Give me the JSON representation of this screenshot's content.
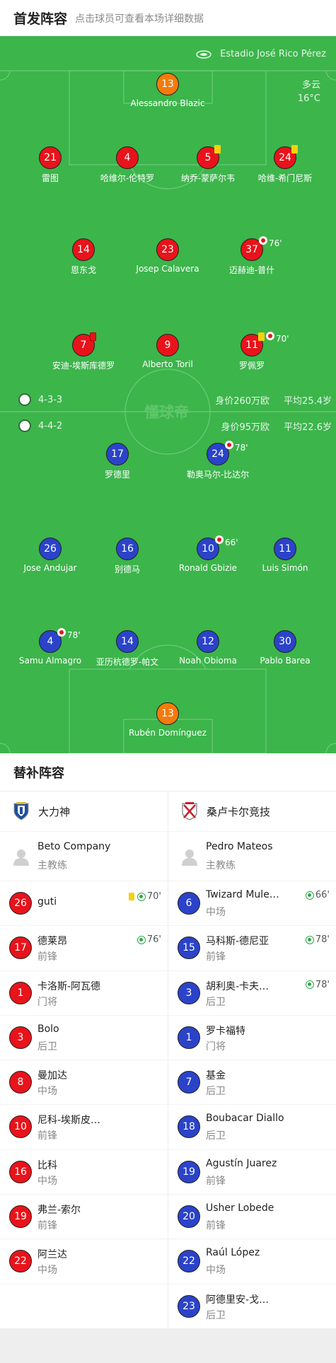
{
  "header": {
    "title": "首发阵容",
    "subtitle": "点击球员可查看本场详细数据"
  },
  "pitch": {
    "venue": "Estadio José Rico Pérez",
    "weather": "多云",
    "temperature": "16°C",
    "watermark": "懂球帝",
    "colors": {
      "grass": "#3cb54b",
      "home": "#e8131b",
      "away": "#2b43c9",
      "goalkeeper": "#f47a0b"
    }
  },
  "home": {
    "formation": "4-3-3",
    "value": "身价260万欧",
    "avg_age": "平均25.4岁",
    "players": [
      {
        "num": "13",
        "name": "Alessandro Blazic",
        "gk": true
      },
      {
        "num": "21",
        "name": "雷图"
      },
      {
        "num": "4",
        "name": "哈维尔-伦特罗"
      },
      {
        "num": "5",
        "name": "纳乔-蒙萨尔韦",
        "yellow": true
      },
      {
        "num": "24",
        "name": "哈维-希门尼斯",
        "yellow": true
      },
      {
        "num": "14",
        "name": "恩东戈"
      },
      {
        "num": "23",
        "name": "Josep Calavera"
      },
      {
        "num": "37",
        "name": "迈赫迪-普什",
        "sub_out": "76'"
      },
      {
        "num": "7",
        "name": "安迪-埃斯库德罗",
        "red": true
      },
      {
        "num": "9",
        "name": "Alberto Toril"
      },
      {
        "num": "11",
        "name": "罗佩罗",
        "yellow": true,
        "sub_out": "70'"
      }
    ]
  },
  "away": {
    "formation": "4-4-2",
    "value": "身价95万欧",
    "avg_age": "平均22.6岁",
    "players": [
      {
        "num": "17",
        "name": "罗德里"
      },
      {
        "num": "24",
        "name": "勒奥马尔-比达尔",
        "sub_out": "78'"
      },
      {
        "num": "26",
        "name": "Jose Andujar"
      },
      {
        "num": "16",
        "name": "别德马"
      },
      {
        "num": "10",
        "name": "Ronald Gbizie",
        "sub_out": "66'"
      },
      {
        "num": "11",
        "name": "Luis Simón"
      },
      {
        "num": "4",
        "name": "Samu Almagro",
        "sub_out": "78'"
      },
      {
        "num": "14",
        "name": "亚历杭德罗-帕文"
      },
      {
        "num": "12",
        "name": "Noah Obioma"
      },
      {
        "num": "30",
        "name": "Pablo Barea"
      },
      {
        "num": "13",
        "name": "Rubén Domínguez",
        "gk": true
      }
    ]
  },
  "subs": {
    "title": "替补阵容",
    "left": {
      "team": "大力神",
      "logo_icon": "hercules-crest-icon",
      "coach_name": "Beto Company",
      "coach_role": "主教练",
      "players": [
        {
          "num": "26",
          "name": "guti",
          "pos": "",
          "yellow": true,
          "in": "70'"
        },
        {
          "num": "17",
          "name": "德莱昂",
          "pos": "前锋",
          "in": "76'"
        },
        {
          "num": "1",
          "name": "卡洛斯-阿瓦德",
          "pos": "门将"
        },
        {
          "num": "3",
          "name": "Bolo",
          "pos": "后卫"
        },
        {
          "num": "8",
          "name": "曼加达",
          "pos": "中场"
        },
        {
          "num": "10",
          "name": "尼科-埃斯皮…",
          "pos": "前锋"
        },
        {
          "num": "16",
          "name": "比科",
          "pos": "中场"
        },
        {
          "num": "19",
          "name": "弗兰-索尔",
          "pos": "前锋"
        },
        {
          "num": "22",
          "name": "阿兰达",
          "pos": "中场"
        }
      ]
    },
    "right": {
      "team": "桑卢卡尔竞技",
      "logo_icon": "sanluqueno-crest-icon",
      "coach_name": "Pedro Mateos",
      "coach_role": "主教练",
      "players": [
        {
          "num": "6",
          "name": "Twizard Mule…",
          "pos": "中场",
          "in": "66'"
        },
        {
          "num": "15",
          "name": "马科斯-德尼亚",
          "pos": "前锋",
          "in": "78'"
        },
        {
          "num": "3",
          "name": "胡利奥-卡夫…",
          "pos": "后卫",
          "in": "78'"
        },
        {
          "num": "1",
          "name": "罗卡福特",
          "pos": "门将"
        },
        {
          "num": "7",
          "name": "基金",
          "pos": "后卫"
        },
        {
          "num": "18",
          "name": "Boubacar Diallo",
          "pos": "后卫"
        },
        {
          "num": "19",
          "name": "Agustín Juarez",
          "pos": "前锋"
        },
        {
          "num": "20",
          "name": "Usher Lobede",
          "pos": "前锋"
        },
        {
          "num": "22",
          "name": "Raúl López",
          "pos": "中场"
        },
        {
          "num": "23",
          "name": "阿德里安-戈…",
          "pos": "后卫"
        }
      ]
    }
  }
}
